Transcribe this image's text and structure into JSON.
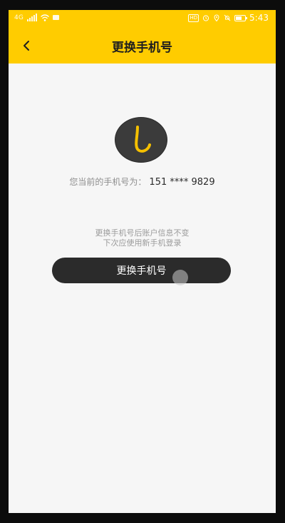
{
  "status_bar": {
    "carrier_text": "4G",
    "hd_badge": "HD",
    "time": "5:43",
    "icons": [
      "signal-icon",
      "wifi-icon",
      "message-icon",
      "alarm-icon",
      "location-icon",
      "mute-icon",
      "battery-icon"
    ]
  },
  "header": {
    "title": "更换手机号",
    "back_icon": "chevron-left-icon"
  },
  "account": {
    "logo_icon": "app-logo-icon",
    "current_label": "您当前的手机号为：",
    "masked_number": "151 **** 9829"
  },
  "notice": {
    "line1": "更换手机号后账户信息不变",
    "line2": "下次应使用新手机登录"
  },
  "actions": {
    "change_button_label": "更换手机号"
  },
  "colors": {
    "brand_yellow": "#ffcc00",
    "button_dark": "#2b2b2b",
    "background": "#f6f6f6",
    "logo_stroke": "#f5c000"
  }
}
